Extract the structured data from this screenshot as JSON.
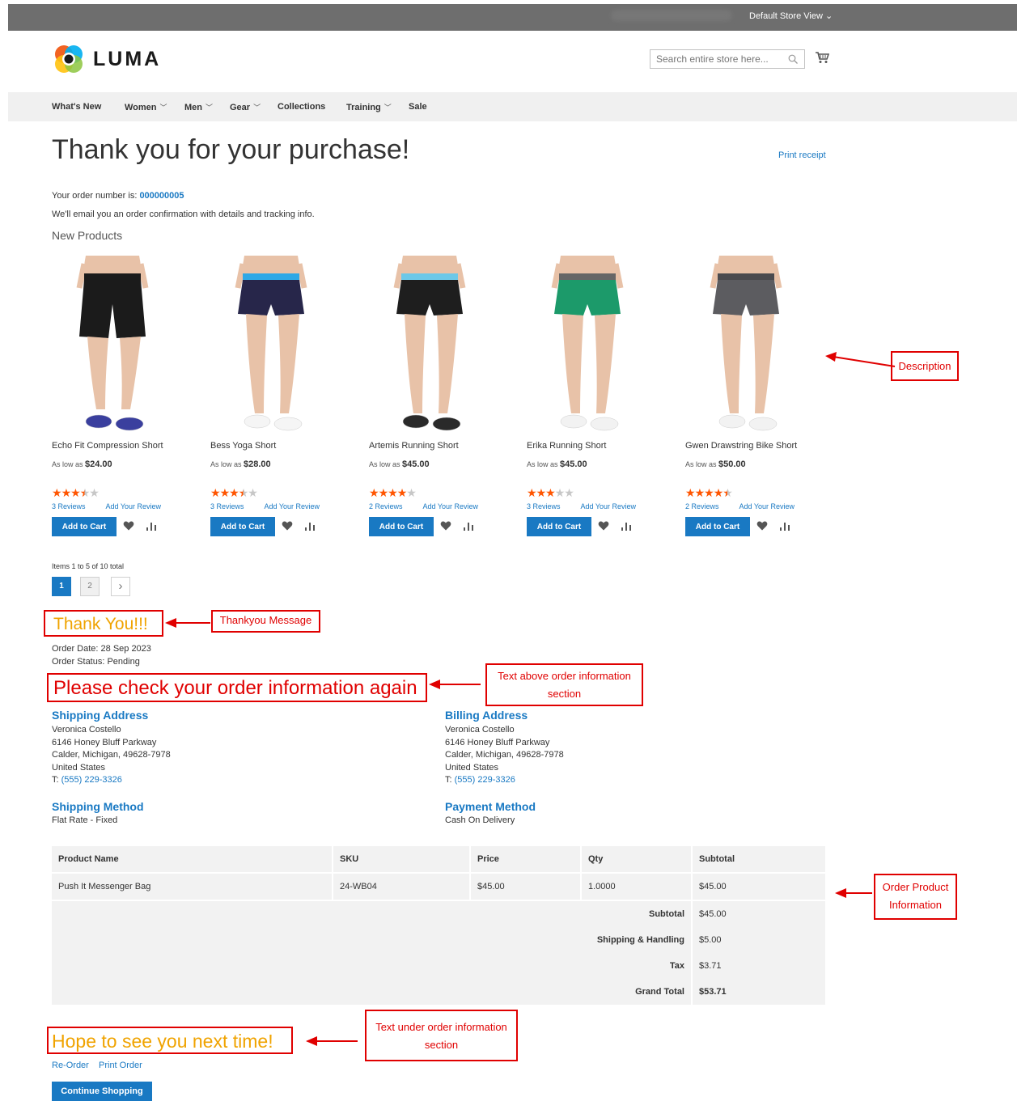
{
  "header": {
    "store_view": "Default Store View",
    "logo_text": "LUMA",
    "search_placeholder": "Search entire store here..."
  },
  "nav": [
    {
      "label": "What's New",
      "dropdown": false
    },
    {
      "label": "Women",
      "dropdown": true
    },
    {
      "label": "Men",
      "dropdown": true
    },
    {
      "label": "Gear",
      "dropdown": true
    },
    {
      "label": "Collections",
      "dropdown": false
    },
    {
      "label": "Training",
      "dropdown": true
    },
    {
      "label": "Sale",
      "dropdown": false
    }
  ],
  "page": {
    "title": "Thank you for your purchase!",
    "print_receipt": "Print receipt",
    "order_number_label": "Your order number is:",
    "order_number": "000000005",
    "email_note": "We'll email you an order confirmation with details and tracking info.",
    "new_products_heading": "New Products"
  },
  "products": [
    {
      "name": "Echo Fit Compression Short",
      "price_prefix": "As low as",
      "price": "$24.00",
      "rating": 3.5,
      "reviews": "3  Reviews",
      "add_review": "Add Your Review",
      "add_to_cart": "Add to Cart"
    },
    {
      "name": "Bess Yoga Short",
      "price_prefix": "As low as",
      "price": "$28.00",
      "rating": 3.5,
      "reviews": "3  Reviews",
      "add_review": "Add Your Review",
      "add_to_cart": "Add to Cart"
    },
    {
      "name": "Artemis Running Short",
      "price_prefix": "As low as",
      "price": "$45.00",
      "rating": 4,
      "reviews": "2  Reviews",
      "add_review": "Add Your Review",
      "add_to_cart": "Add to Cart"
    },
    {
      "name": "Erika Running Short",
      "price_prefix": "As low as",
      "price": "$45.00",
      "rating": 3,
      "reviews": "3  Reviews",
      "add_review": "Add Your Review",
      "add_to_cart": "Add to Cart"
    },
    {
      "name": "Gwen Drawstring Bike Short",
      "price_prefix": "As low as",
      "price": "$50.00",
      "rating": 4.5,
      "reviews": "2  Reviews",
      "add_review": "Add Your Review",
      "add_to_cart": "Add to Cart"
    }
  ],
  "pagination": {
    "items_text": "Items 1 to 5 of 10 total",
    "pages": [
      "1",
      "2"
    ],
    "next": "›"
  },
  "order": {
    "thank_you": "Thank You!!!",
    "order_date": "Order Date: 28 Sep 2023",
    "order_status": "Order Status: Pending",
    "check_text": "Please check your order information again",
    "shipping_address_heading": "Shipping Address",
    "billing_address_heading": "Billing Address",
    "address": {
      "name": "Veronica Costello",
      "street": "6146 Honey Bluff Parkway",
      "city": "Calder, Michigan, 49628-7978",
      "country": "United States",
      "phone_prefix": "T: ",
      "phone": "(555) 229-3326"
    },
    "shipping_method_heading": "Shipping Method",
    "shipping_method": "Flat Rate - Fixed",
    "payment_method_heading": "Payment Method",
    "payment_method": "Cash On Delivery",
    "table": {
      "headers": [
        "Product Name",
        "SKU",
        "Price",
        "Qty",
        "Subtotal"
      ],
      "rows": [
        [
          "Push It Messenger Bag",
          "24-WB04",
          "$45.00",
          "1.0000",
          "$45.00"
        ]
      ],
      "totals": [
        {
          "label": "Subtotal",
          "value": "$45.00"
        },
        {
          "label": "Shipping & Handling",
          "value": "$5.00"
        },
        {
          "label": "Tax",
          "value": "$3.71"
        },
        {
          "label": "Grand Total",
          "value": "$53.71"
        }
      ]
    },
    "hope_text": "Hope to see you next time!",
    "reorder": "Re-Order",
    "print_order": "Print Order",
    "continue_shopping": "Continue Shopping"
  },
  "annotations": {
    "description": "Description",
    "thankyou_message": "Thankyou Message",
    "text_above_line1": "Text above order information",
    "text_above_line2": "section",
    "order_product_line1": "Order Product",
    "order_product_line2": "Information",
    "text_under_line1": "Text under order information",
    "text_under_line2": "section"
  },
  "colors": {
    "accent": "#1979c3",
    "star": "#ff5501",
    "annotation": "#e00000",
    "highlight_orange": "#f0a300"
  }
}
